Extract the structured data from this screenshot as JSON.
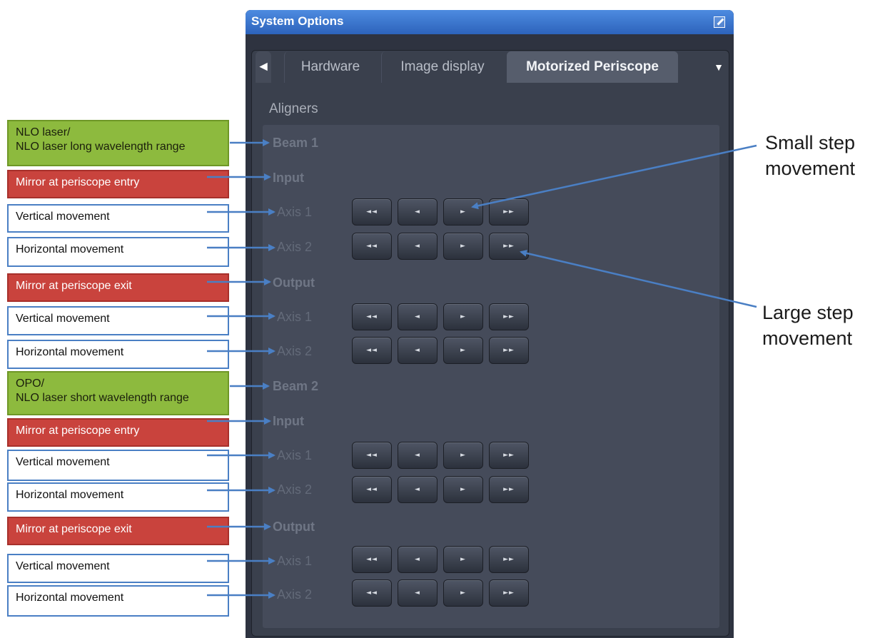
{
  "window": {
    "title": "System Options"
  },
  "tabs": {
    "scroll_left": "◄",
    "items": [
      "Hardware",
      "Image display",
      "Motorized Periscope"
    ],
    "active": "Motorized Periscope",
    "dropdown": "▼"
  },
  "panel": {
    "section_label": "Aligners",
    "beam1": "Beam 1",
    "beam2": "Beam 2",
    "input": "Input",
    "output": "Output",
    "axis1": "Axis 1",
    "axis2": "Axis 2"
  },
  "step_buttons": {
    "large_back": "◄◄",
    "small_back": "◄",
    "small_fwd": "►",
    "large_fwd": "►►"
  },
  "callouts": {
    "nlo_laser_line1": "NLO laser/",
    "nlo_laser_line2": "NLO laser long wavelength range",
    "mirror_entry": "Mirror at periscope entry",
    "mirror_exit": "Mirror at periscope exit",
    "vertical": "Vertical movement",
    "horizontal": "Horizontal movement",
    "opo_line1": "OPO/",
    "opo_line2": "NLO laser short wavelength range"
  },
  "side_notes": {
    "small_step_line1": "Small step",
    "small_step_line2": "movement",
    "large_step_line1": "Large step",
    "large_step_line2": "movement"
  },
  "colors": {
    "title_bar": "#3f78d1",
    "panel_bg": "#3a404d",
    "callout_green": "#8dba3e",
    "callout_red": "#c9433d",
    "callout_border_blue": "#4a7fc4",
    "arrow_blue": "#4a7fc4"
  }
}
